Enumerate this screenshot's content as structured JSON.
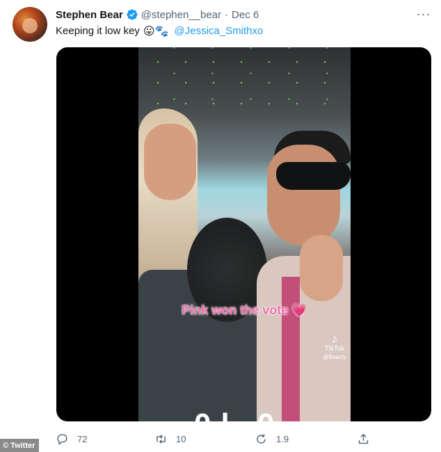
{
  "tweet": {
    "author_name": "Stephen Bear",
    "handle": "@stephen__bear",
    "separator": "·",
    "date": "Dec 6",
    "text": "Keeping it low key",
    "emojis": "😛🐾",
    "mention": "@Jessica_Smithxo",
    "more_label": "···"
  },
  "media": {
    "overlay_caption": "Pink won the vote 💗",
    "tiktok_label": "TikTok",
    "tiktok_user": "@Bearzy",
    "bottom_cutoff_text": "0l  0"
  },
  "actions": {
    "reply_count": "72",
    "retweet_count": "10",
    "like_count": "1.9"
  },
  "watermark": "© Twitter",
  "colors": {
    "link": "#1d9bf0",
    "secondary_text": "#536471",
    "verified": "#1d9bf0",
    "caption_pink": "#f06fa9"
  }
}
